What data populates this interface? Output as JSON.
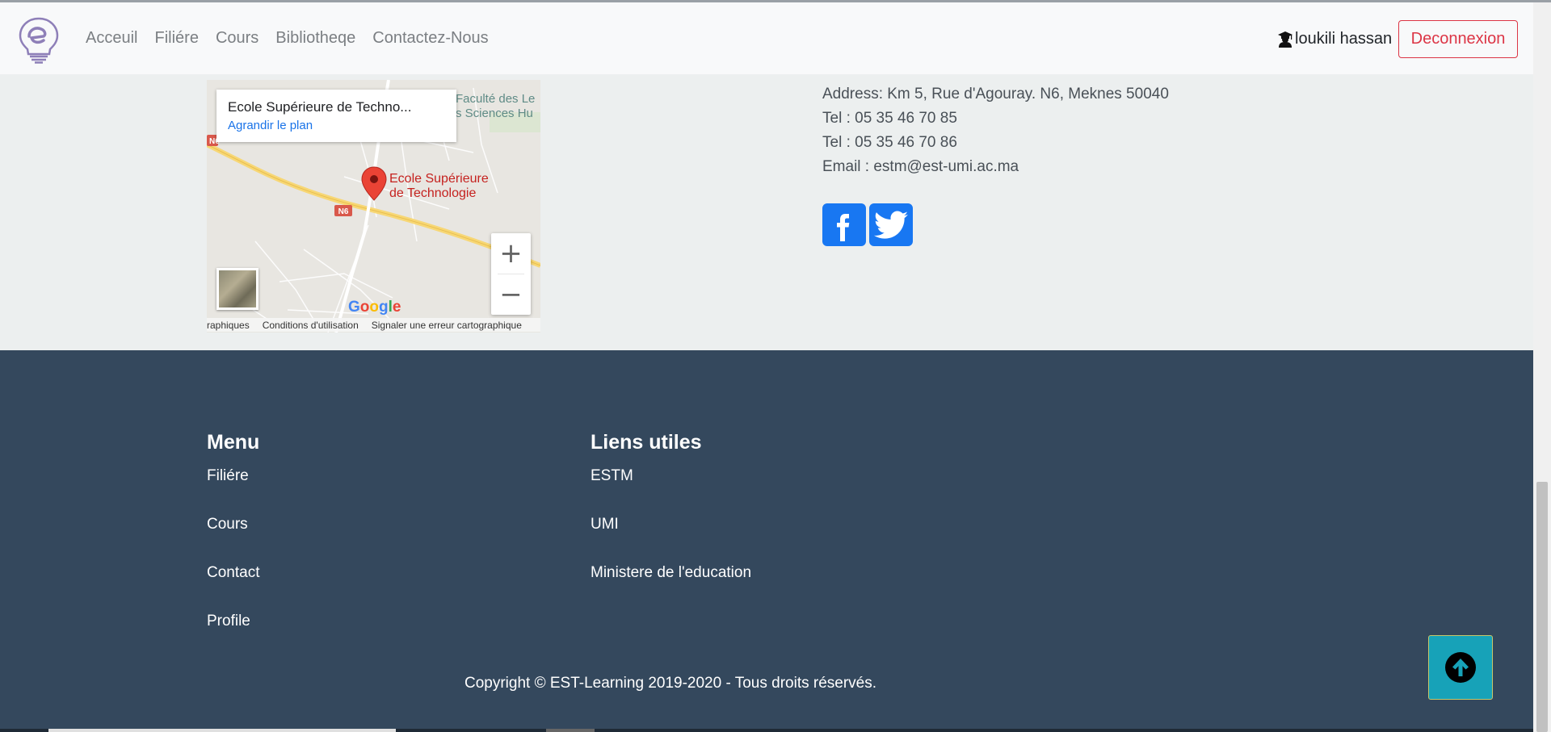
{
  "navbar": {
    "links": [
      "Acceuil",
      "Filiére",
      "Cours",
      "Bibliotheqe",
      "Contactez-Nous"
    ],
    "user_name": "loukili hassan",
    "logout_label": "Deconnexion"
  },
  "map": {
    "place_title": "Ecole Supérieure de Techno...",
    "enlarge_link": "Agrandir le plan",
    "marker_label_line1": "Ecole Supérieure",
    "marker_label_line2": "de Technologie",
    "nearby_label_line1": "Faculté des Le",
    "nearby_label_line2": "s Sciences Hu",
    "road_label": "N6",
    "road_label_left": "N6",
    "logo": "Google",
    "footer_links": [
      "raphiques",
      "Conditions d'utilisation",
      "Signaler une erreur cartographique"
    ],
    "zoom_in": "+",
    "zoom_out": "−"
  },
  "contact": {
    "address": "Address: Km 5, Rue d'Agouray. N6, Meknes 50040",
    "tel1": "Tel : 05 35 46 70 85",
    "tel2": "Tel : 05 35 46 70 86",
    "email": "Email : estm@est-umi.ac.ma",
    "social_icons": [
      "facebook-icon",
      "twitter-icon"
    ]
  },
  "footer": {
    "menu_heading": "Menu",
    "menu_items": [
      "Filiére",
      "Cours",
      "Contact",
      "Profile"
    ],
    "links_heading": "Liens utiles",
    "links_items": [
      "ESTM",
      "UMI",
      "Ministere de l'education"
    ],
    "copyright": "Copyright © EST-Learning 2019-2020 - Tous droits réservés."
  },
  "colors": {
    "navbar_bg": "#f8f9fa",
    "logout": "#dc3545",
    "footer_bg": "#34485d",
    "social": "#1877f2",
    "scroll_top": "#17a2b8"
  }
}
